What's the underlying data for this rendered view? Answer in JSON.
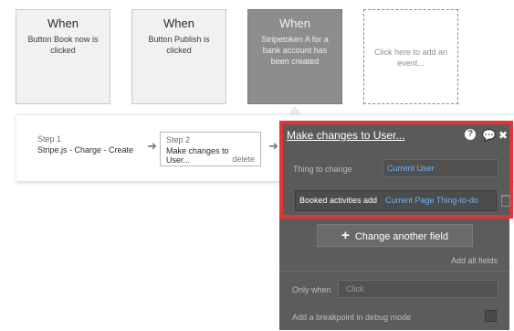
{
  "events": [
    {
      "when": "When",
      "desc": "Button Book now is clicked"
    },
    {
      "when": "When",
      "desc": "Button Publish is clicked"
    },
    {
      "when": "When",
      "desc": "Stripetoken A for a bank account has been created"
    },
    {
      "desc": "Click here to add an event..."
    }
  ],
  "steps": [
    {
      "num": "Step 1",
      "name": "Stripe.js - Charge - Create"
    },
    {
      "num": "Step 2",
      "name": "Make changes to User...",
      "delete": "delete"
    }
  ],
  "panel": {
    "title": "Make changes to User...",
    "icons": [
      "help-icon",
      "comment-icon",
      "close-icon"
    ],
    "thing_label": "Thing to change",
    "thing_value": "Current User",
    "field_label": "Booked activities add",
    "field_value": "Current Page Thing-to-do",
    "change_another": "Change another field",
    "add_all": "Add all fields",
    "only_when_label": "Only when",
    "only_when_placeholder": "Click",
    "breakpoint_label": "Add a breakpoint in debug mode"
  },
  "colors": {
    "highlight": "#e53232",
    "link": "#6fb0ee",
    "panel": "#5c5c5c"
  }
}
